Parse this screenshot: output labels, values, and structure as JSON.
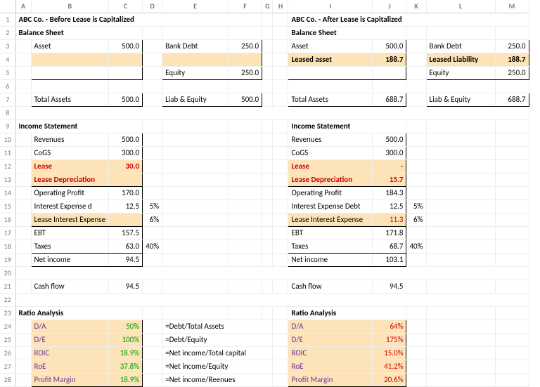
{
  "cols": [
    "A",
    "B",
    "C",
    "D",
    "E",
    "F",
    "G",
    "H",
    "I",
    "J",
    "K",
    "L",
    "M"
  ],
  "left": {
    "title": "ABC Co. - Before Lease is Capitalized",
    "bs_heading": "Balance Sheet",
    "bs": {
      "asset_lbl": "Asset",
      "asset_val": "500.0",
      "leased_asset_lbl": "",
      "leased_asset_val": "",
      "bankdebt_lbl": "Bank Debt",
      "bankdebt_val": "250.0",
      "equity_lbl": "Equity",
      "equity_val": "250.0",
      "ta_lbl": "Total Assets",
      "ta_val": "500.0",
      "le_lbl": "Liab & Equity",
      "le_val": "500.0"
    },
    "is_heading": "Income Statement",
    "is": {
      "rev_lbl": "Revenues",
      "rev_val": "500.0",
      "cogs_lbl": "CoGS",
      "cogs_val": "300.0",
      "lease_lbl": "Lease",
      "lease_val": "30.0",
      "dep_lbl": "Lease Depreciation",
      "dep_val": "",
      "op_lbl": "Operating Profit",
      "op_val": "170.0",
      "int_lbl": "Interest Expense d",
      "int_val": "12.5",
      "int_rate": "5%",
      "lie_lbl": "Lease Interest Expense",
      "lie_val": "",
      "lie_rate": "6%",
      "ebt_lbl": "EBT",
      "ebt_val": "157.5",
      "tax_lbl": "Taxes",
      "tax_val": "63.0",
      "tax_rate": "40%",
      "ni_lbl": "Net income",
      "ni_val": "94.5",
      "cf_lbl": "Cash flow",
      "cf_val": "94.5"
    },
    "ra_heading": "Ratio Analysis",
    "ra": {
      "da_lbl": "D/A",
      "da_val": "50%",
      "de_lbl": "D/E",
      "de_val": "100%",
      "roic_lbl": "ROIC",
      "roic_val": "18.9%",
      "roe_lbl": "RoE",
      "roe_val": "37.8%",
      "pm_lbl": "Profit Margin",
      "pm_val": "18.9%"
    }
  },
  "right": {
    "title": "ABC Co. - After Lease is Capitalized",
    "bs_heading": "Balance Sheet",
    "bs": {
      "asset_lbl": "Asset",
      "asset_val": "500.0",
      "leased_asset_lbl": "Leased asset",
      "leased_asset_val": "188.7",
      "bankdebt_lbl": "Bank Debt",
      "bankdebt_val": "250.0",
      "ll_lbl": "Leased Liability",
      "ll_val": "188.7",
      "equity_lbl": "Equity",
      "equity_val": "250.0",
      "ta_lbl": "Total Assets",
      "ta_val": "688.7",
      "le_lbl": "Liab & Equity",
      "le_val": "688.7"
    },
    "is_heading": "Income Statement",
    "is": {
      "rev_lbl": "Revenues",
      "rev_val": "500.0",
      "cogs_lbl": "CoGS",
      "cogs_val": "300.0",
      "lease_lbl": "Lease",
      "lease_val": "-",
      "dep_lbl": "Lease Depreciation",
      "dep_val": "15.7",
      "op_lbl": "Operating Profit",
      "op_val": "184.3",
      "int_lbl": "Interest Expense Debt",
      "int_val": "12.5",
      "int_rate": "5%",
      "lie_lbl": "Lease Interest Expense",
      "lie_val": "11.3",
      "lie_rate": "6%",
      "ebt_lbl": "EBT",
      "ebt_val": "171.8",
      "tax_lbl": "Taxes",
      "tax_val": "68.7",
      "tax_rate": "40%",
      "ni_lbl": "Net income",
      "ni_val": "103.1",
      "cf_lbl": "Cash flow",
      "cf_val": "94.5"
    },
    "ra_heading": "Ratio Analysis",
    "ra": {
      "da_lbl": "D/A",
      "da_val": "64%",
      "de_lbl": "D/E",
      "de_val": "175%",
      "roic_lbl": "ROIC",
      "roic_val": "15.0%",
      "roe_lbl": "RoE",
      "roe_val": "41.2%",
      "pm_lbl": "Profit Margin",
      "pm_val": "20.6%"
    }
  },
  "formulas": {
    "da": "=Debt/Total Assets",
    "de": "=Debt/Equity",
    "roic": "=Net income/Total capital",
    "roe": "=Net income/Equity",
    "pm": "=Net income/Reenues"
  }
}
